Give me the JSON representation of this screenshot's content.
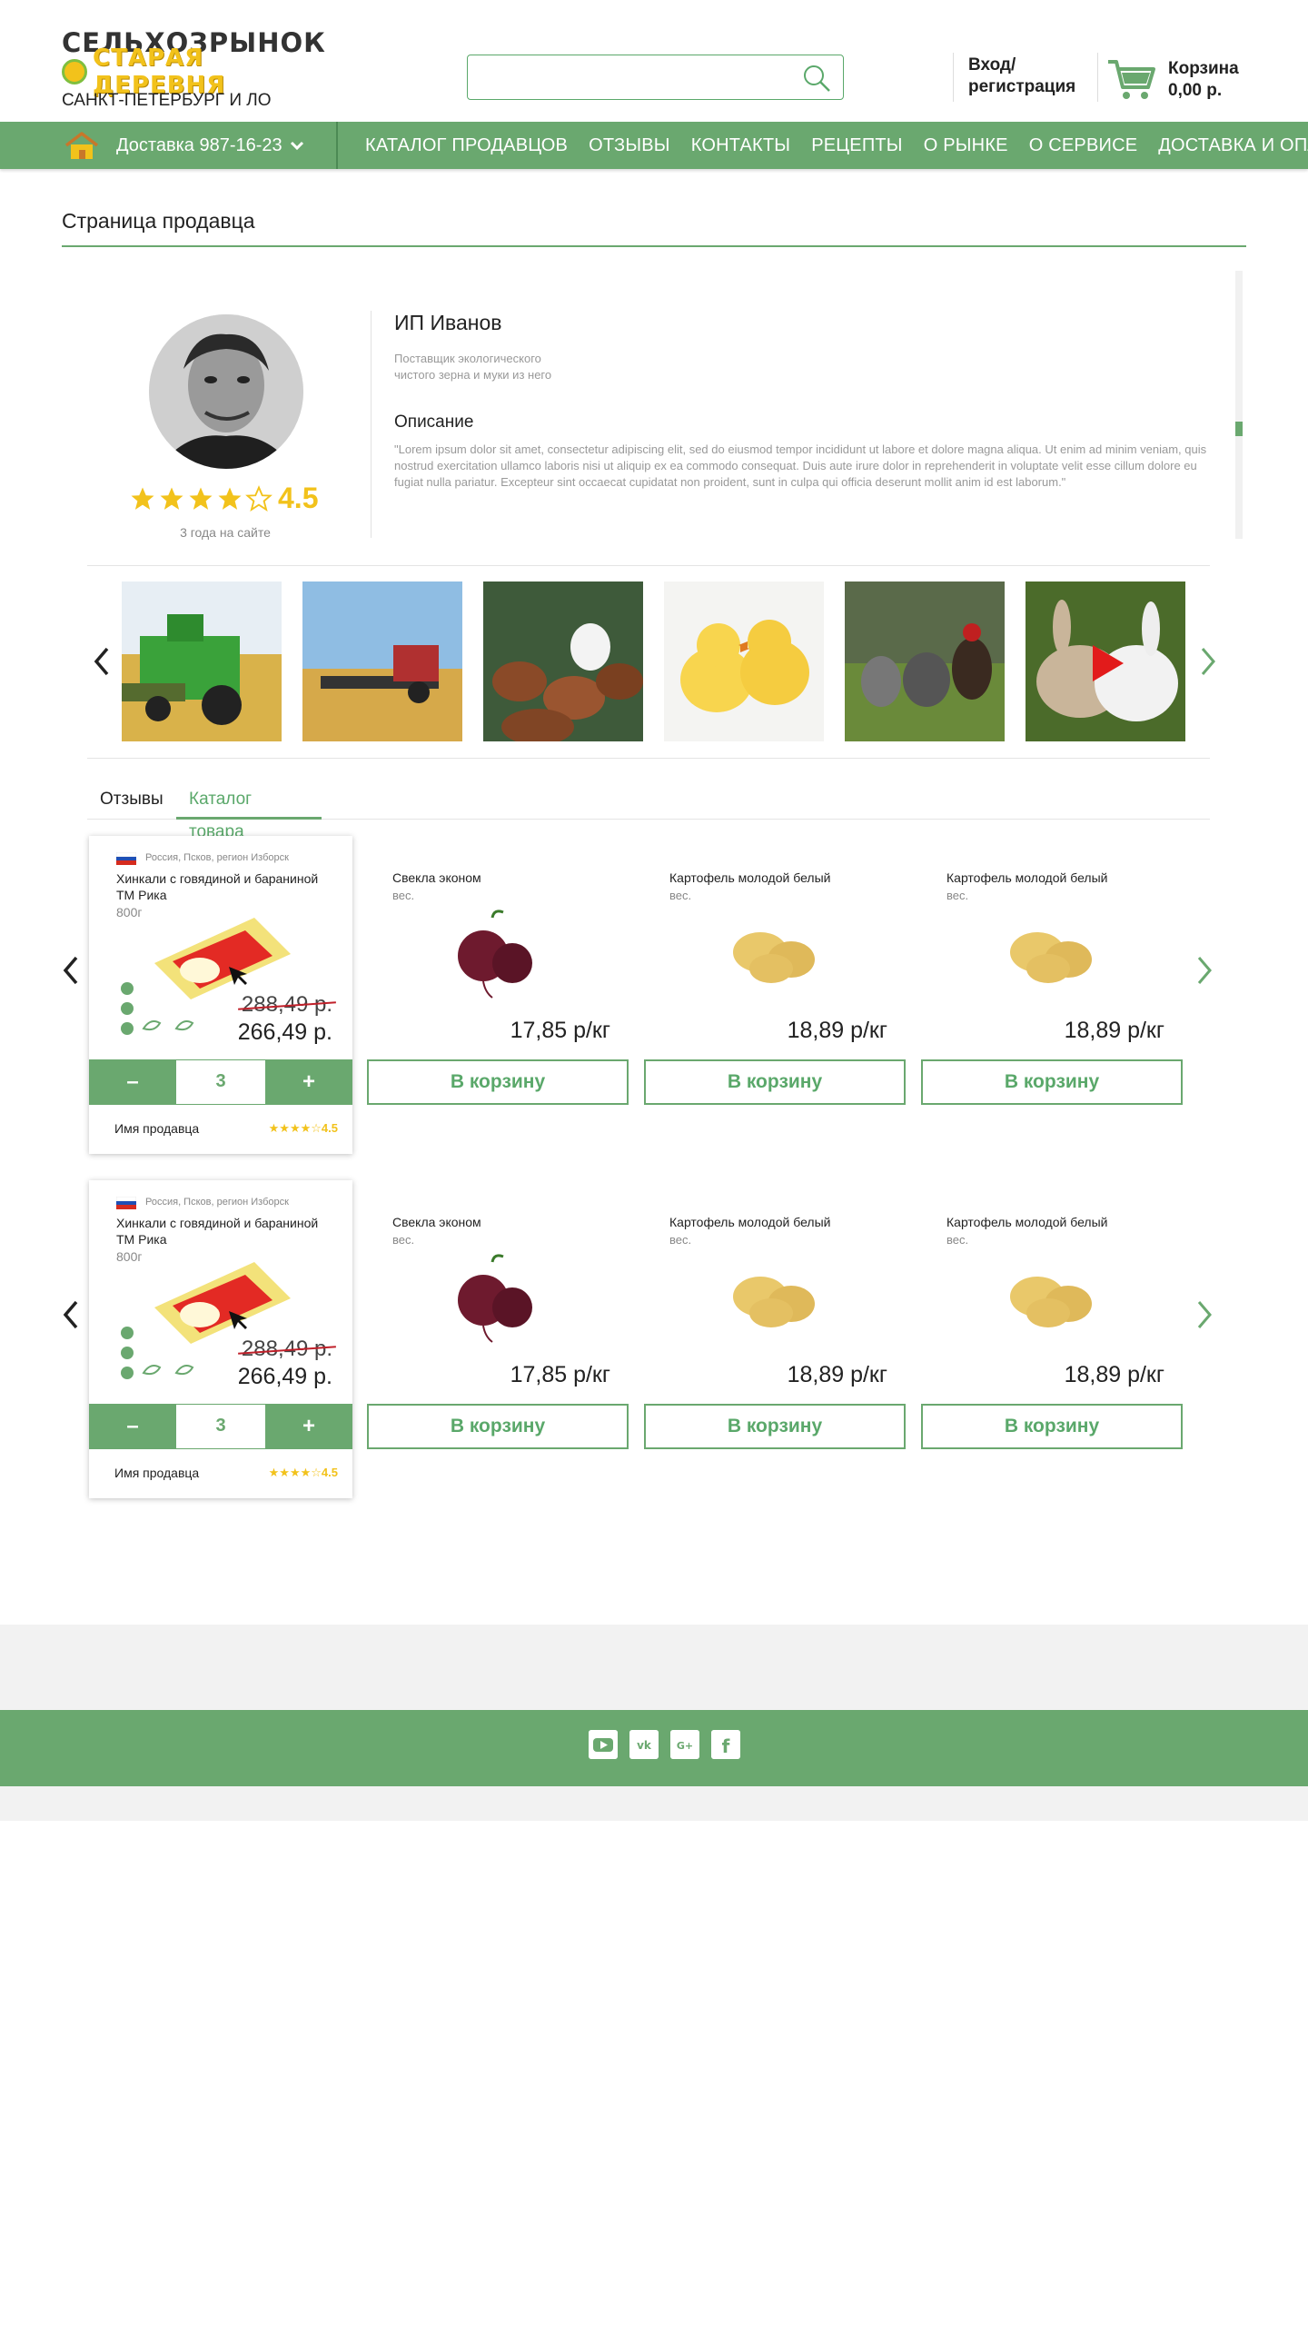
{
  "header": {
    "logo_top": "СЕЛЬХОЗРЫНОК",
    "logo_mid": "СТАРАЯ ДЕРЕВНЯ",
    "logo_bottom": "САНКТ-ПЕТЕРБУРГ И ЛО",
    "search_placeholder": "",
    "login_line1": "Вход/",
    "login_line2": "регистрация",
    "cart_label": "Корзина",
    "cart_total": "0,00 р."
  },
  "nav": {
    "delivery": "Доставка  987-16-23",
    "items": [
      "КАТАЛОГ ПРОДАВЦОВ",
      "ОТЗЫВЫ",
      "КОНТАКТЫ",
      "РЕЦЕПТЫ",
      "О РЫНКЕ",
      "О СЕРВИСЕ",
      "ДОСТАВКА И ОПЛАТА"
    ]
  },
  "page": {
    "title": "Страница продавца"
  },
  "seller": {
    "name": "ИП Иванов",
    "subtitle": "Поставщик экологического чистого зерна и муки из него",
    "rating": "4.5",
    "rating_value": 4.5,
    "on_site": "3 года на сайте",
    "desc_title": "Описание",
    "desc_text": "\"Lorem ipsum dolor sit amet, consectetur adipiscing elit, sed do eiusmod tempor incididunt ut labore et dolore magna aliqua. Ut enim ad minim veniam, quis nostrud exercitation ullamco laboris nisi ut aliquip ex ea commodo consequat. Duis aute irure dolor in reprehenderit in voluptate velit esse cillum dolore eu fugiat nulla pariatur. Excepteur sint occaecat cupidatat non proident, sunt in culpa qui officia deserunt mollit anim id est laborum.\""
  },
  "gallery": {
    "items": [
      "combine-harvester-photo",
      "wheat-harvest-photo",
      "hens-photo",
      "chicks-photo",
      "roosters-photo",
      "rabbits-video"
    ]
  },
  "tabs": {
    "reviews": "Отзывы",
    "catalog": "Каталог товара"
  },
  "rows": [
    {
      "featured": {
        "origin": "Россия, Псков, регион Изборск",
        "title": "Хинкали с говядиной и бараниной ТМ Рика",
        "weight": "800г",
        "old_price": "288,49 р.",
        "new_price": "266,49 р.",
        "qty": "3",
        "minus": "–",
        "plus": "+",
        "seller": "Имя продавца",
        "rating": "★★★★☆4.5"
      },
      "items": [
        {
          "title": "Свекла эконом",
          "unit": "вес.",
          "price": "17,85 р/кг",
          "button": "В корзину"
        },
        {
          "title": "Картофель молодой белый",
          "unit": "вес.",
          "price": "18,89 р/кг",
          "button": "В корзину"
        },
        {
          "title": "Картофель молодой белый",
          "unit": "вес.",
          "price": "18,89 р/кг",
          "button": "В корзину"
        }
      ]
    },
    {
      "featured": {
        "origin": "Россия, Псков, регион Изборск",
        "title": "Хинкали с говядиной и бараниной ТМ Рика",
        "weight": "800г",
        "old_price": "288,49 р.",
        "new_price": "266,49 р.",
        "qty": "3",
        "minus": "–",
        "plus": "+",
        "seller": "Имя продавца",
        "rating": "★★★★☆4.5"
      },
      "items": [
        {
          "title": "Свекла эконом",
          "unit": "вес.",
          "price": "17,85 р/кг",
          "button": "В корзину"
        },
        {
          "title": "Картофель молодой белый",
          "unit": "вес.",
          "price": "18,89 р/кг",
          "button": "В корзину"
        },
        {
          "title": "Картофель молодой белый",
          "unit": "вес.",
          "price": "18,89 р/кг",
          "button": "В корзину"
        }
      ]
    }
  ],
  "footer": {
    "social": [
      "youtube-icon",
      "vk-icon",
      "google-plus-icon",
      "facebook-icon"
    ]
  },
  "colors": {
    "brand_green": "#6aa86f",
    "accent_yellow": "#f2c21b",
    "sale_red": "#c0202a"
  }
}
